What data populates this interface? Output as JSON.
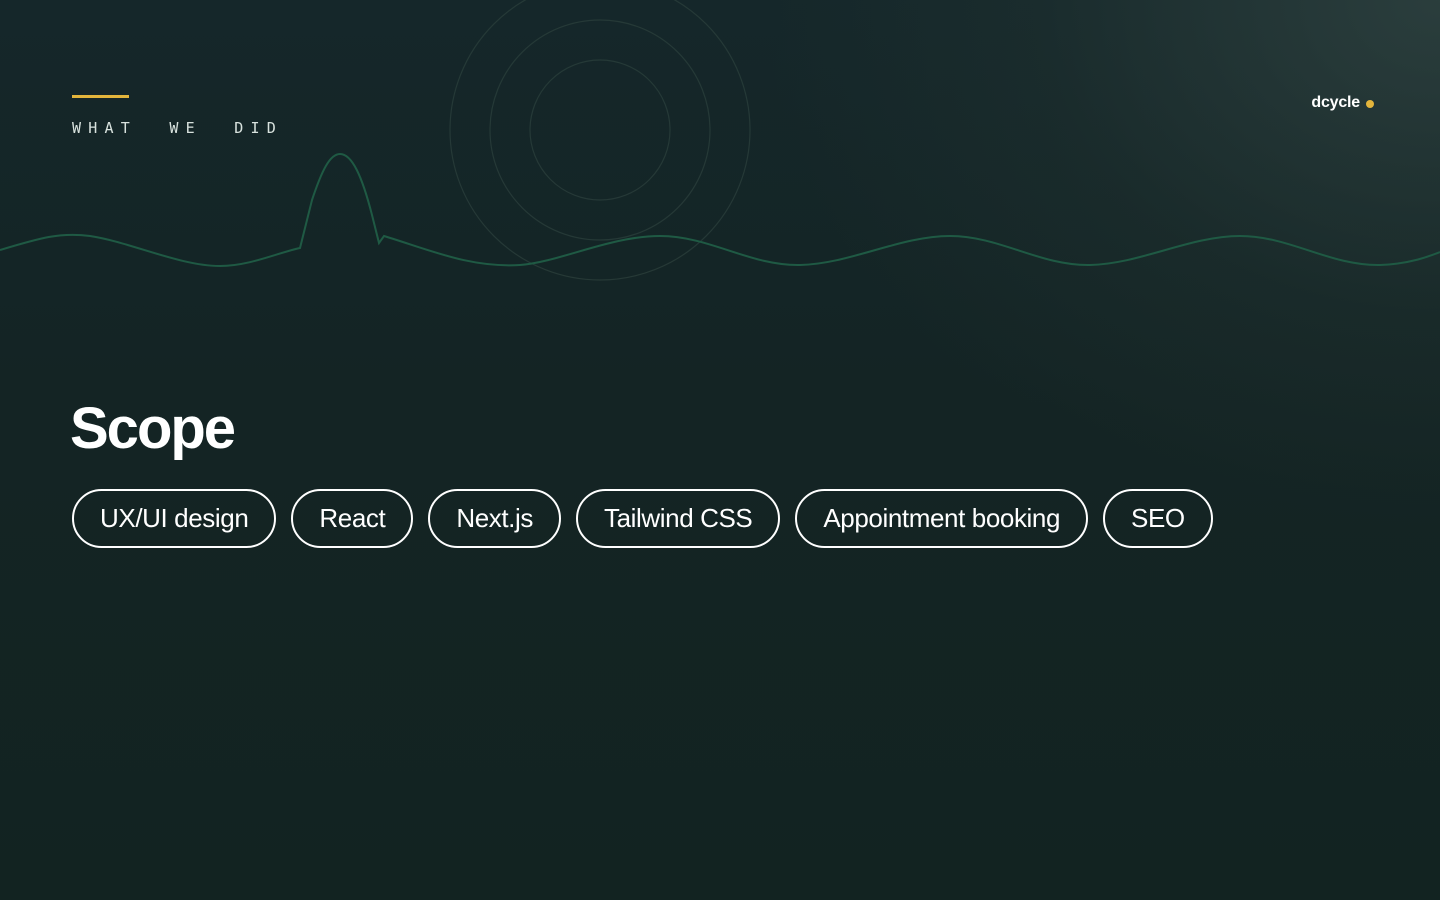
{
  "header": {
    "eyebrow": "WHAT  WE  DID",
    "brand_name": "dcycle"
  },
  "main": {
    "title": "Scope",
    "tags": [
      "UX/UI design",
      "React",
      "Next.js",
      "Tailwind CSS",
      "Appointment booking",
      "SEO"
    ]
  },
  "colors": {
    "accent": "#e3b53c",
    "background": "#142424",
    "text": "#ffffff",
    "line": "#1f5a44"
  }
}
